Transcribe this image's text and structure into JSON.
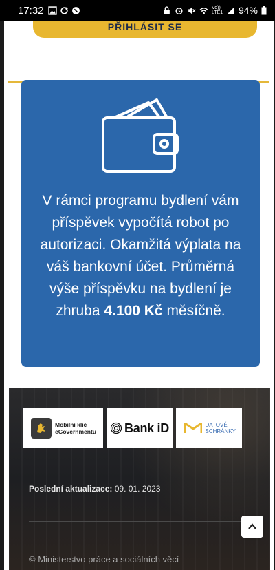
{
  "status_bar": {
    "time": "17:32",
    "network": "Vo)) LTE1",
    "battery": "94%"
  },
  "login": {
    "label": "PŘIHLÁSIT SE"
  },
  "info_card": {
    "text_before": "V rámci programu bydlení vám příspěvek vypočítá robot po autorizaci. Okamžitá výplata na váš bankovní účet. Průměrná výše příspěvku na bydlení je zhruba ",
    "text_strong": "4.100 Kč",
    "text_after": " měsíčně."
  },
  "footer": {
    "logos": {
      "mobilni_klic": "Mobilní klíč eGovernmentu",
      "bank_id": "Bank iD",
      "datove_schranky": "DATOVÉ SCHRÁNKY"
    },
    "updated_label": "Poslední aktualizace:",
    "updated_value": "09. 01. 2023",
    "copyright": "© Ministerstvo práce a sociálních věcí"
  },
  "colors": {
    "accent_yellow": "#e8b730",
    "card_blue": "#2b67ab"
  }
}
